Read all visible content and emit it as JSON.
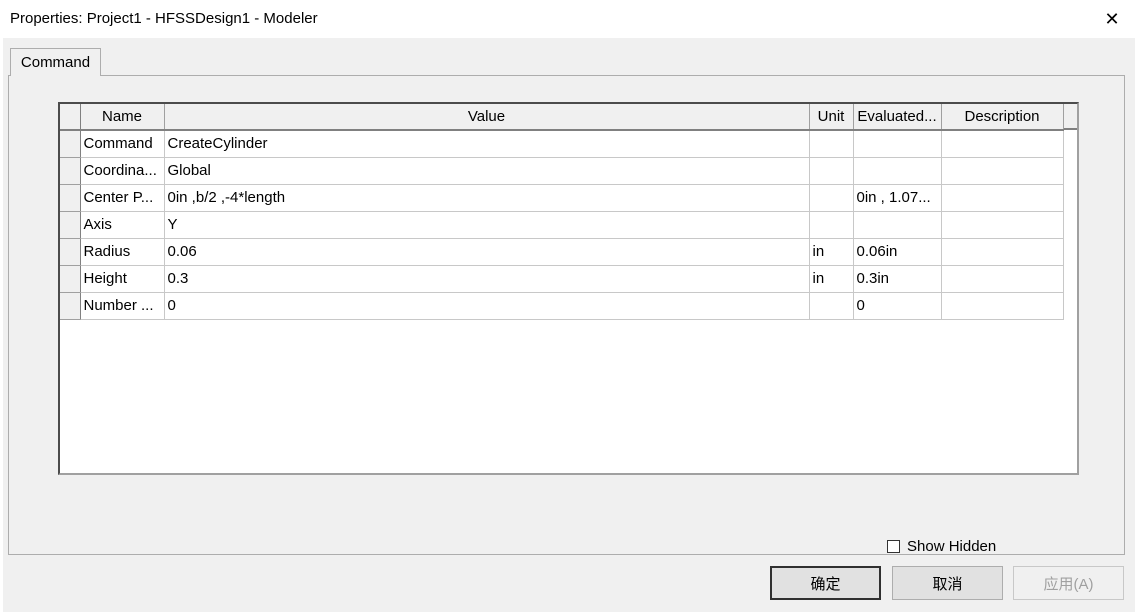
{
  "window": {
    "title": "Properties: Project1 - HFSSDesign1 - Modeler",
    "close_glyph": "✕"
  },
  "tabs": [
    {
      "label": "Command"
    }
  ],
  "grid": {
    "columns": [
      "Name",
      "Value",
      "Unit",
      "Evaluated...",
      "Description"
    ],
    "rows": [
      {
        "name": "Command",
        "value": "CreateCylinder",
        "unit": "",
        "evaluated": "",
        "description": ""
      },
      {
        "name": "Coordina...",
        "value": "Global",
        "unit": "",
        "evaluated": "",
        "description": ""
      },
      {
        "name": "Center P...",
        "value": "0in ,b/2 ,-4*length",
        "unit": "",
        "evaluated": "0in , 1.07...",
        "description": ""
      },
      {
        "name": "Axis",
        "value": "Y",
        "unit": "",
        "evaluated": "",
        "description": ""
      },
      {
        "name": "Radius",
        "value": "0.06",
        "unit": "in",
        "evaluated": "0.06in",
        "description": ""
      },
      {
        "name": "Height",
        "value": "0.3",
        "unit": "in",
        "evaluated": "0.3in",
        "description": ""
      },
      {
        "name": "Number ...",
        "value": "0",
        "unit": "",
        "evaluated": "0",
        "description": ""
      }
    ]
  },
  "options": {
    "show_hidden_label": "Show Hidden",
    "show_hidden_checked": false
  },
  "buttons": {
    "ok_label": "确定",
    "cancel_label": "取消",
    "apply_label": "应用(A)"
  }
}
